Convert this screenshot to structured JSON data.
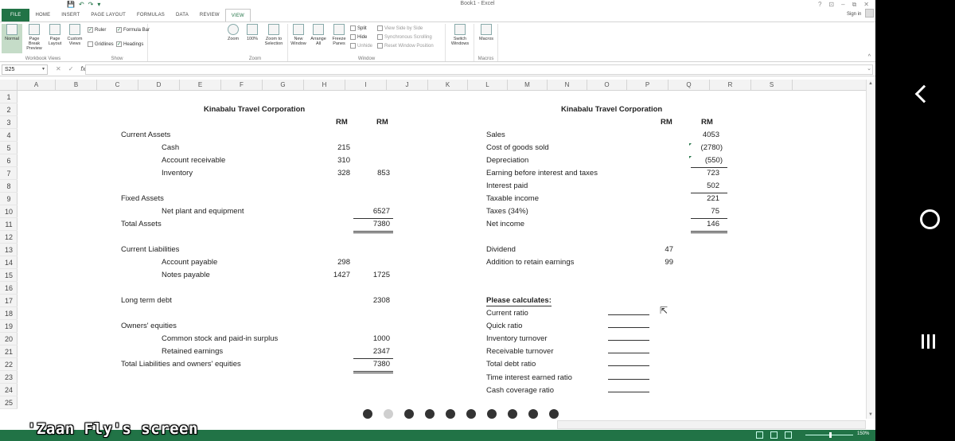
{
  "window": {
    "title": "Book1 - Excel",
    "controls": [
      "?",
      "⊡",
      "–",
      "⧉",
      "✕"
    ]
  },
  "qat": [
    "💾",
    "↶",
    "↷",
    "▾"
  ],
  "tabs": [
    "FILE",
    "HOME",
    "INSERT",
    "PAGE LAYOUT",
    "FORMULAS",
    "DATA",
    "REVIEW",
    "VIEW"
  ],
  "active_tab": "VIEW",
  "signin": "Sign in",
  "ribbon": {
    "workbook_views": {
      "label": "Workbook Views",
      "normal": "Normal",
      "page_break": "Page Break Preview",
      "page_layout": "Page Layout",
      "custom_views": "Custom Views"
    },
    "show": {
      "label": "Show",
      "ruler": "Ruler",
      "formula_bar": "Formula Bar",
      "gridlines": "Gridlines",
      "headings": "Headings"
    },
    "zoom": {
      "label": "Zoom",
      "zoom": "Zoom",
      "zoom100": "100%",
      "zoom_selection": "Zoom to Selection"
    },
    "window": {
      "label": "Window",
      "new_window": "New Window",
      "arrange_all": "Arrange All",
      "freeze_panes": "Freeze Panes",
      "split": "Split",
      "hide": "Hide",
      "unhide": "Unhide",
      "side_by_side": "View Side by Side",
      "sync_scroll": "Synchronous Scrolling",
      "reset_pos": "Reset Window Position",
      "switch_windows": "Switch Windows"
    },
    "macros": {
      "label": "Macros",
      "macros": "Macros"
    }
  },
  "formula_bar": {
    "name_box": "S25",
    "fx": "fx",
    "value": ""
  },
  "columns": [
    "A",
    "B",
    "C",
    "D",
    "E",
    "F",
    "G",
    "H",
    "I",
    "J",
    "K",
    "L",
    "M",
    "N",
    "O",
    "P",
    "Q",
    "R",
    "S"
  ],
  "rows": [
    "1",
    "2",
    "3",
    "4",
    "5",
    "6",
    "7",
    "8",
    "9",
    "10",
    "11",
    "12",
    "13",
    "14",
    "15",
    "16",
    "17",
    "18",
    "19",
    "20",
    "21",
    "22",
    "23",
    "24",
    "25"
  ],
  "balance_sheet": {
    "title": "Kinabalu Travel Corporation",
    "col_g": "RM",
    "col_h": "RM",
    "current_assets": "Current Assets",
    "cash": "Cash",
    "cash_v": "215",
    "ar": "Account receivable",
    "ar_v": "310",
    "inventory": "Inventory",
    "inventory_v": "328",
    "ca_total": "853",
    "fixed_assets": "Fixed Assets",
    "net_plant": "Net plant and equipment",
    "net_plant_v": "6527",
    "total_assets": "Total Assets",
    "total_assets_v": "7380",
    "current_liab": "Current Liabilities",
    "ap": "Account payable",
    "ap_v": "298",
    "np": "Notes payable",
    "np_v": "1427",
    "cl_total": "1725",
    "ltd": "Long term debt",
    "ltd_v": "2308",
    "owners": "Owners' equities",
    "common": "Common stock and paid-in surplus",
    "common_v": "1000",
    "retained": "Retained earnings",
    "retained_v": "2347",
    "total_le": "Total Liabilities and owners' equities",
    "total_le_v": "7380"
  },
  "income_statement": {
    "title": "Kinabalu Travel Corporation",
    "col_o": "RM",
    "col_p": "RM",
    "sales": "Sales",
    "sales_v": "4053",
    "cogs": "Cost of goods sold",
    "cogs_v": "(2780)",
    "dep": "Depreciation",
    "dep_v": "(550)",
    "ebit": "Earning before interest and taxes",
    "ebit_v": "723",
    "interest": "Interest paid",
    "interest_v": "502",
    "taxable": "Taxable income",
    "taxable_v": "221",
    "taxes": "Taxes (34%)",
    "taxes_v": "75",
    "net": "Net income",
    "net_v": "146",
    "dividend": "Dividend",
    "dividend_v": "47",
    "retain": "Addition to retain earnings",
    "retain_v": "99"
  },
  "questions": {
    "heading": "Please calculates:",
    "items": [
      "Current ratio",
      "Quick ratio",
      "Inventory turnover",
      "Receivable turnover",
      "Total debt ratio",
      "Time interest earned ratio",
      "Cash coverage ratio"
    ]
  },
  "status": {
    "zoom": "150%"
  },
  "watermark": "'Zaan Fly's screen",
  "pagination": {
    "total": 10,
    "current": 2
  }
}
